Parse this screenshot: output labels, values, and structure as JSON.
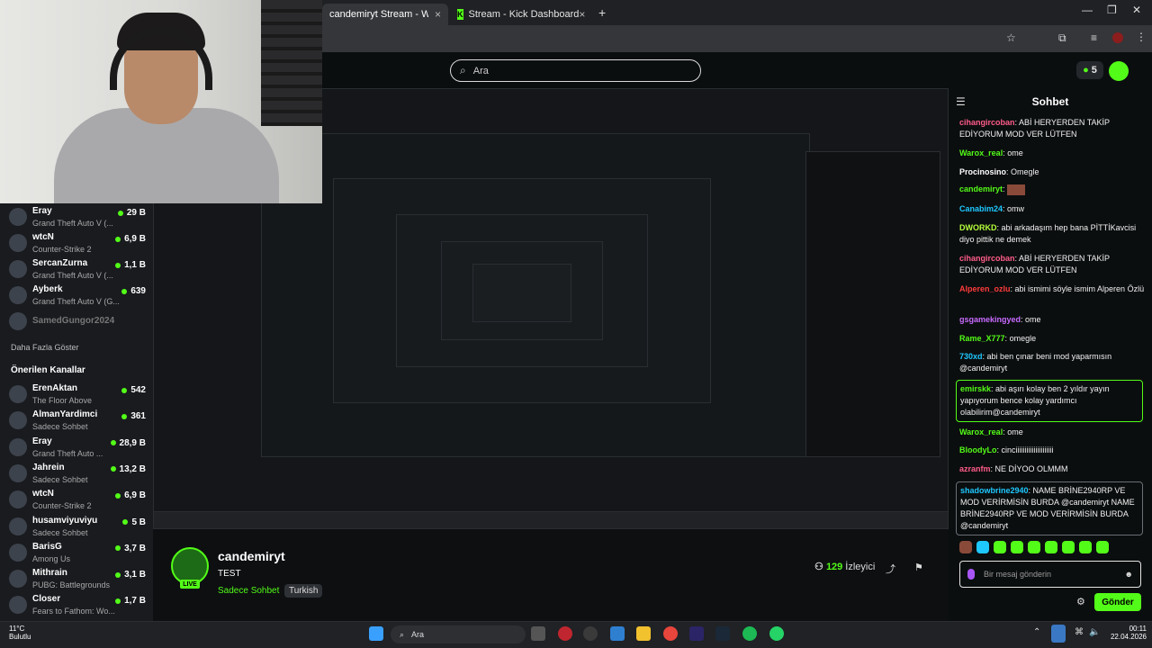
{
  "browser": {
    "tabs": [
      {
        "label": "candemiryt Stream - Watch Liv",
        "active": true
      },
      {
        "label": "Stream - Kick Dashboard",
        "active": false
      }
    ]
  },
  "header": {
    "search_placeholder": "Ara",
    "points_badge": "5"
  },
  "sidebar": {
    "followed": [
      {
        "name": "Eray",
        "game": "Grand Theft Auto V (...",
        "viewers": "29 B",
        "live": true
      },
      {
        "name": "wtcN",
        "game": "Counter-Strike 2",
        "viewers": "6,9 B",
        "live": true
      },
      {
        "name": "SercanZurna",
        "game": "Grand Theft Auto V (...",
        "viewers": "1,1 B",
        "live": true
      },
      {
        "name": "Ayberk",
        "game": "Grand Theft Auto V (G...",
        "viewers": "639",
        "live": true
      },
      {
        "name": "SamedGungor2024",
        "game": "",
        "viewers": "",
        "live": false
      }
    ],
    "show_more": "Daha Fazla Göster",
    "recommended_title": "Önerilen Kanallar",
    "recommended": [
      {
        "name": "ErenAktan",
        "game": "The Floor Above",
        "viewers": "542"
      },
      {
        "name": "AlmanYardimci",
        "game": "Sadece Sohbet",
        "viewers": "361"
      },
      {
        "name": "Eray",
        "game": "Grand Theft Auto ...",
        "viewers": "28,9 B"
      },
      {
        "name": "Jahrein",
        "game": "Sadece Sohbet",
        "viewers": "13,2 B"
      },
      {
        "name": "wtcN",
        "game": "Counter-Strike 2",
        "viewers": "6,9 B"
      },
      {
        "name": "husamviyuviyu",
        "game": "Sadece Sohbet",
        "viewers": "5 B"
      },
      {
        "name": "BarisG",
        "game": "Among Us",
        "viewers": "3,7 B"
      },
      {
        "name": "Mithrain",
        "game": "PUBG: Battlegrounds",
        "viewers": "3,1 B"
      },
      {
        "name": "Closer",
        "game": "Fears to Fathom: Wo...",
        "viewers": "1,7 B"
      }
    ]
  },
  "stream": {
    "channel": "candemiryt",
    "title": "TEST",
    "category": "Sadece Sohbet",
    "tag": "Turkish",
    "live_label": "LIVE",
    "viewers": "129",
    "viewers_label": "İzleyici"
  },
  "chat": {
    "title": "Sohbet",
    "messages": [
      {
        "user": "cihangircoban",
        "color": "#ff5c8a",
        "text": "ABİ HERYERDEN TAKİP EDİYORUM MOD VER LÜTFEN",
        "style": ""
      },
      {
        "user": "Warox_real",
        "color": "#53fc18",
        "text": "ome",
        "style": ""
      },
      {
        "user": "Procinosino",
        "color": "#ffffff",
        "text": "Omegle",
        "style": ""
      },
      {
        "user": "candemiryt",
        "color": "#53fc18",
        "text": "",
        "style": ""
      },
      {
        "user": "Canabim24",
        "color": "#1ec8ff",
        "text": "omw",
        "style": ""
      },
      {
        "user": "DWORKD",
        "color": "#b6ff3b",
        "text": "abi arkadaşım hep bana PİTTİKavcisi diyo pittik ne demek",
        "style": ""
      },
      {
        "user": "cihangircoban",
        "color": "#ff5c8a",
        "text": "ABİ HERYERDEN TAKİP EDİYORUM MOD VER LÜTFEN",
        "style": ""
      },
      {
        "user": "Alperen_ozlu",
        "color": "#ff3b3b",
        "text": "abi ismimi söyle ismim Alperen Özlü",
        "style": ""
      },
      {
        "user": "gsgamekingyed",
        "color": "#c86bff",
        "text": "ome",
        "style": ""
      },
      {
        "user": "Rame_X777",
        "color": "#53fc18",
        "text": "omegle",
        "style": ""
      },
      {
        "user": "730xd",
        "color": "#1ec8ff",
        "text": "abi ben çınar beni mod yaparmısın @candemiryt",
        "style": ""
      },
      {
        "user": "emirskk",
        "color": "#53fc18",
        "text": "abi aşırı kolay ben 2 yıldır yayın yapıyorum bence kolay yardımcı olabilirim@candemiryt",
        "style": "box"
      },
      {
        "user": "Warox_real",
        "color": "#53fc18",
        "text": "ome",
        "style": ""
      },
      {
        "user": "BloodyLo",
        "color": "#53fc18",
        "text": "cinciiiiiiiiiiiiiiiiiiiii",
        "style": ""
      },
      {
        "user": "azranfm",
        "color": "#ff5c8a",
        "text": "NE DİYOO OLMMM",
        "style": ""
      },
      {
        "user": "shadowbrine2940",
        "color": "#1ec8ff",
        "text": "NAME BRİNE2940RP VE MOD VERİRMİSİN BURDA @candemiryt NAME BRİNE2940RP VE MOD VERİRMİSİN BURDA @candemiryt",
        "style": "box gray"
      }
    ],
    "input_placeholder": "Bir mesaj gönderin",
    "send_label": "Gönder"
  },
  "taskbar": {
    "weather_temp": "11°C",
    "weather_desc": "Bulutlu",
    "search_placeholder": "Ara",
    "time": "00:11",
    "date": "22.04.2026"
  },
  "colors": {
    "accent": "#53fc18",
    "background": "#0b0e0f",
    "sidebar": "#191b1f"
  }
}
